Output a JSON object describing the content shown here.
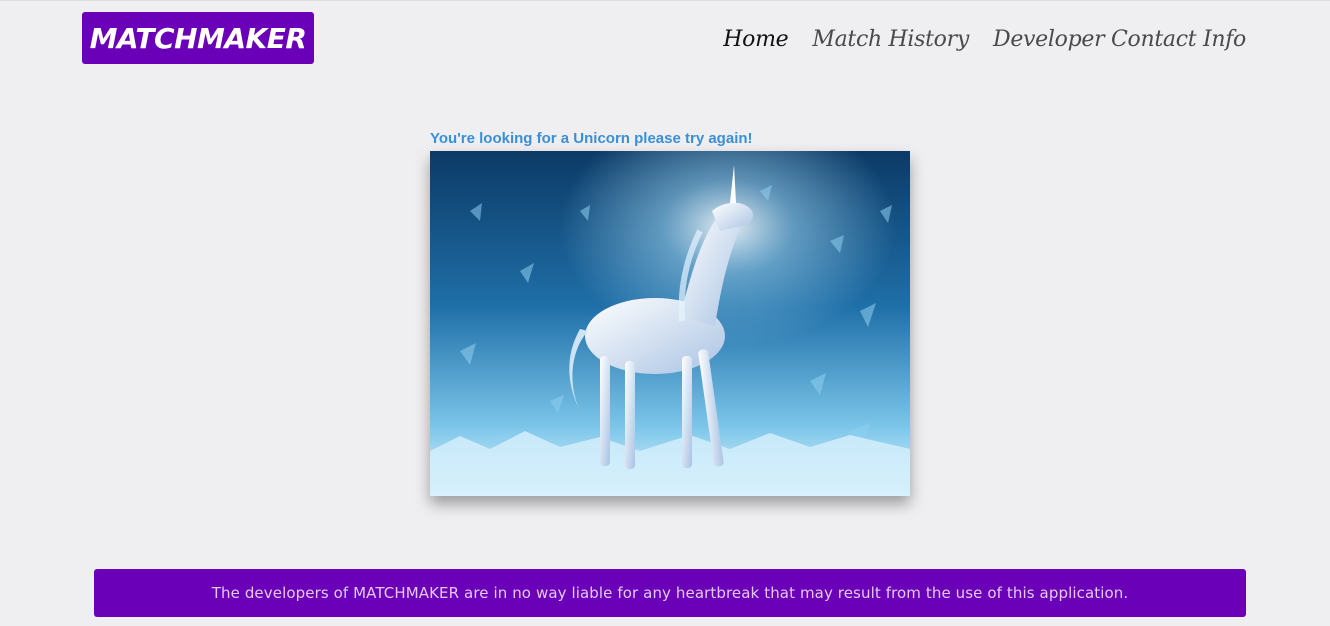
{
  "header": {
    "brand": "MATCHMAKER",
    "nav": [
      {
        "label": "Home",
        "active": true
      },
      {
        "label": "Match History",
        "active": false
      },
      {
        "label": "Developer Contact Info",
        "active": false
      }
    ]
  },
  "main": {
    "result_message": "You're looking for a Unicorn please try again!",
    "image": {
      "subject": "unicorn-image"
    }
  },
  "footer": {
    "disclaimer": "The developers of MATCHMAKER are in no way liable for any heartbreak that may result from the use of this application."
  },
  "colors": {
    "brand_purple": "#6a00b8",
    "page_background": "#efeff1",
    "message_blue": "#3a8fd6",
    "footer_text": "#e3c9ef"
  }
}
